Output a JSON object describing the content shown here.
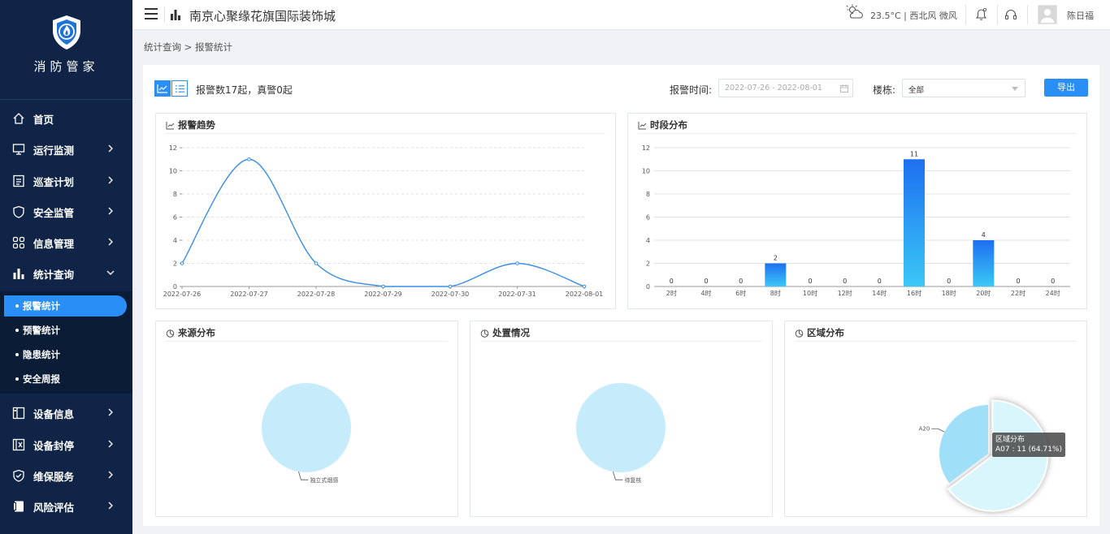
{
  "app": {
    "name": "消防管家"
  },
  "sidebar": {
    "items": [
      {
        "label": "首页",
        "icon": "home-icon",
        "has_submenu": false
      },
      {
        "label": "运行监测",
        "icon": "monitor-icon",
        "has_submenu": true
      },
      {
        "label": "巡查计划",
        "icon": "checklist-icon",
        "has_submenu": true
      },
      {
        "label": "安全监管",
        "icon": "shield-icon",
        "has_submenu": true
      },
      {
        "label": "信息管理",
        "icon": "grid-icon",
        "has_submenu": true
      },
      {
        "label": "统计查询",
        "icon": "bar-chart-icon",
        "has_submenu": true,
        "expanded": true
      },
      {
        "label": "设备信息",
        "icon": "device-icon",
        "has_submenu": true
      },
      {
        "label": "设备封停",
        "icon": "device-lock-icon",
        "has_submenu": true
      },
      {
        "label": "维保服务",
        "icon": "maintenance-icon",
        "has_submenu": true
      },
      {
        "label": "风险评估",
        "icon": "risk-icon",
        "has_submenu": true
      }
    ],
    "subitems": [
      {
        "label": "报警统计",
        "active": true
      },
      {
        "label": "预警统计",
        "active": false
      },
      {
        "label": "隐患统计",
        "active": false
      },
      {
        "label": "安全周报",
        "active": false
      }
    ]
  },
  "header": {
    "org_name": "南京心聚缘花旗国际装饰城",
    "weather": "23.5°C | 西北风 微风",
    "user_name": "陈日福"
  },
  "breadcrumb": "统计查询 > 报警统计",
  "toolbar": {
    "summary": "报警数17起，真警0起",
    "time_label": "报警时间:",
    "time_range": "2022-07-26 - 2022-08-01",
    "building_label": "楼栋:",
    "building_value": "全部",
    "export_label": "导出"
  },
  "colors": {
    "sidebar_bg": "#0f2446",
    "accent": "#2a8ef7",
    "line": "#3a8ee6",
    "bar_top": "#1e6ff0",
    "bar_bottom": "#3ac8f6",
    "pie_light": "#c6ecfb"
  },
  "charts": {
    "trend": {
      "title": "报警趋势"
    },
    "hourly": {
      "title": "时段分布"
    },
    "source": {
      "title": "来源分布"
    },
    "handling": {
      "title": "处置情况"
    },
    "area": {
      "title": "区域分布"
    }
  },
  "chart_data": [
    {
      "type": "line",
      "title": "报警趋势",
      "x": [
        "2022-07-26",
        "2022-07-27",
        "2022-07-28",
        "2022-07-29",
        "2022-07-30",
        "2022-07-31",
        "2022-08-01"
      ],
      "series": [
        {
          "values": [
            2,
            11,
            2,
            0,
            0,
            2,
            0
          ]
        }
      ],
      "ylim": [
        0,
        12
      ],
      "yticks": [
        0,
        2,
        4,
        6,
        8,
        10,
        12
      ],
      "grid": "horizontal-dashed"
    },
    {
      "type": "bar",
      "title": "时段分布",
      "categories": [
        "2时",
        "4时",
        "6时",
        "8时",
        "10时",
        "12时",
        "14时",
        "16时",
        "18时",
        "20时",
        "22时",
        "24时"
      ],
      "values": [
        0,
        0,
        0,
        2,
        0,
        0,
        0,
        11,
        0,
        4,
        0,
        0
      ],
      "ylim": [
        0,
        12
      ],
      "yticks": [
        0,
        2,
        4,
        6,
        8,
        10,
        12
      ],
      "grid": "horizontal"
    },
    {
      "type": "pie",
      "title": "来源分布",
      "slices": [
        {
          "label": "独立式烟感",
          "value": 1
        }
      ]
    },
    {
      "type": "pie",
      "title": "处置情况",
      "slices": [
        {
          "label": "待复核",
          "value": 1
        }
      ]
    },
    {
      "type": "pie",
      "title": "区域分布",
      "slices": [
        {
          "label": "A07",
          "value": 11,
          "percent": 64.71
        },
        {
          "label": "A20",
          "value": 6,
          "percent": 35.29
        }
      ],
      "tooltip": {
        "title": "区域分布",
        "text": "A07 : 11 (64.71%)"
      }
    }
  ]
}
